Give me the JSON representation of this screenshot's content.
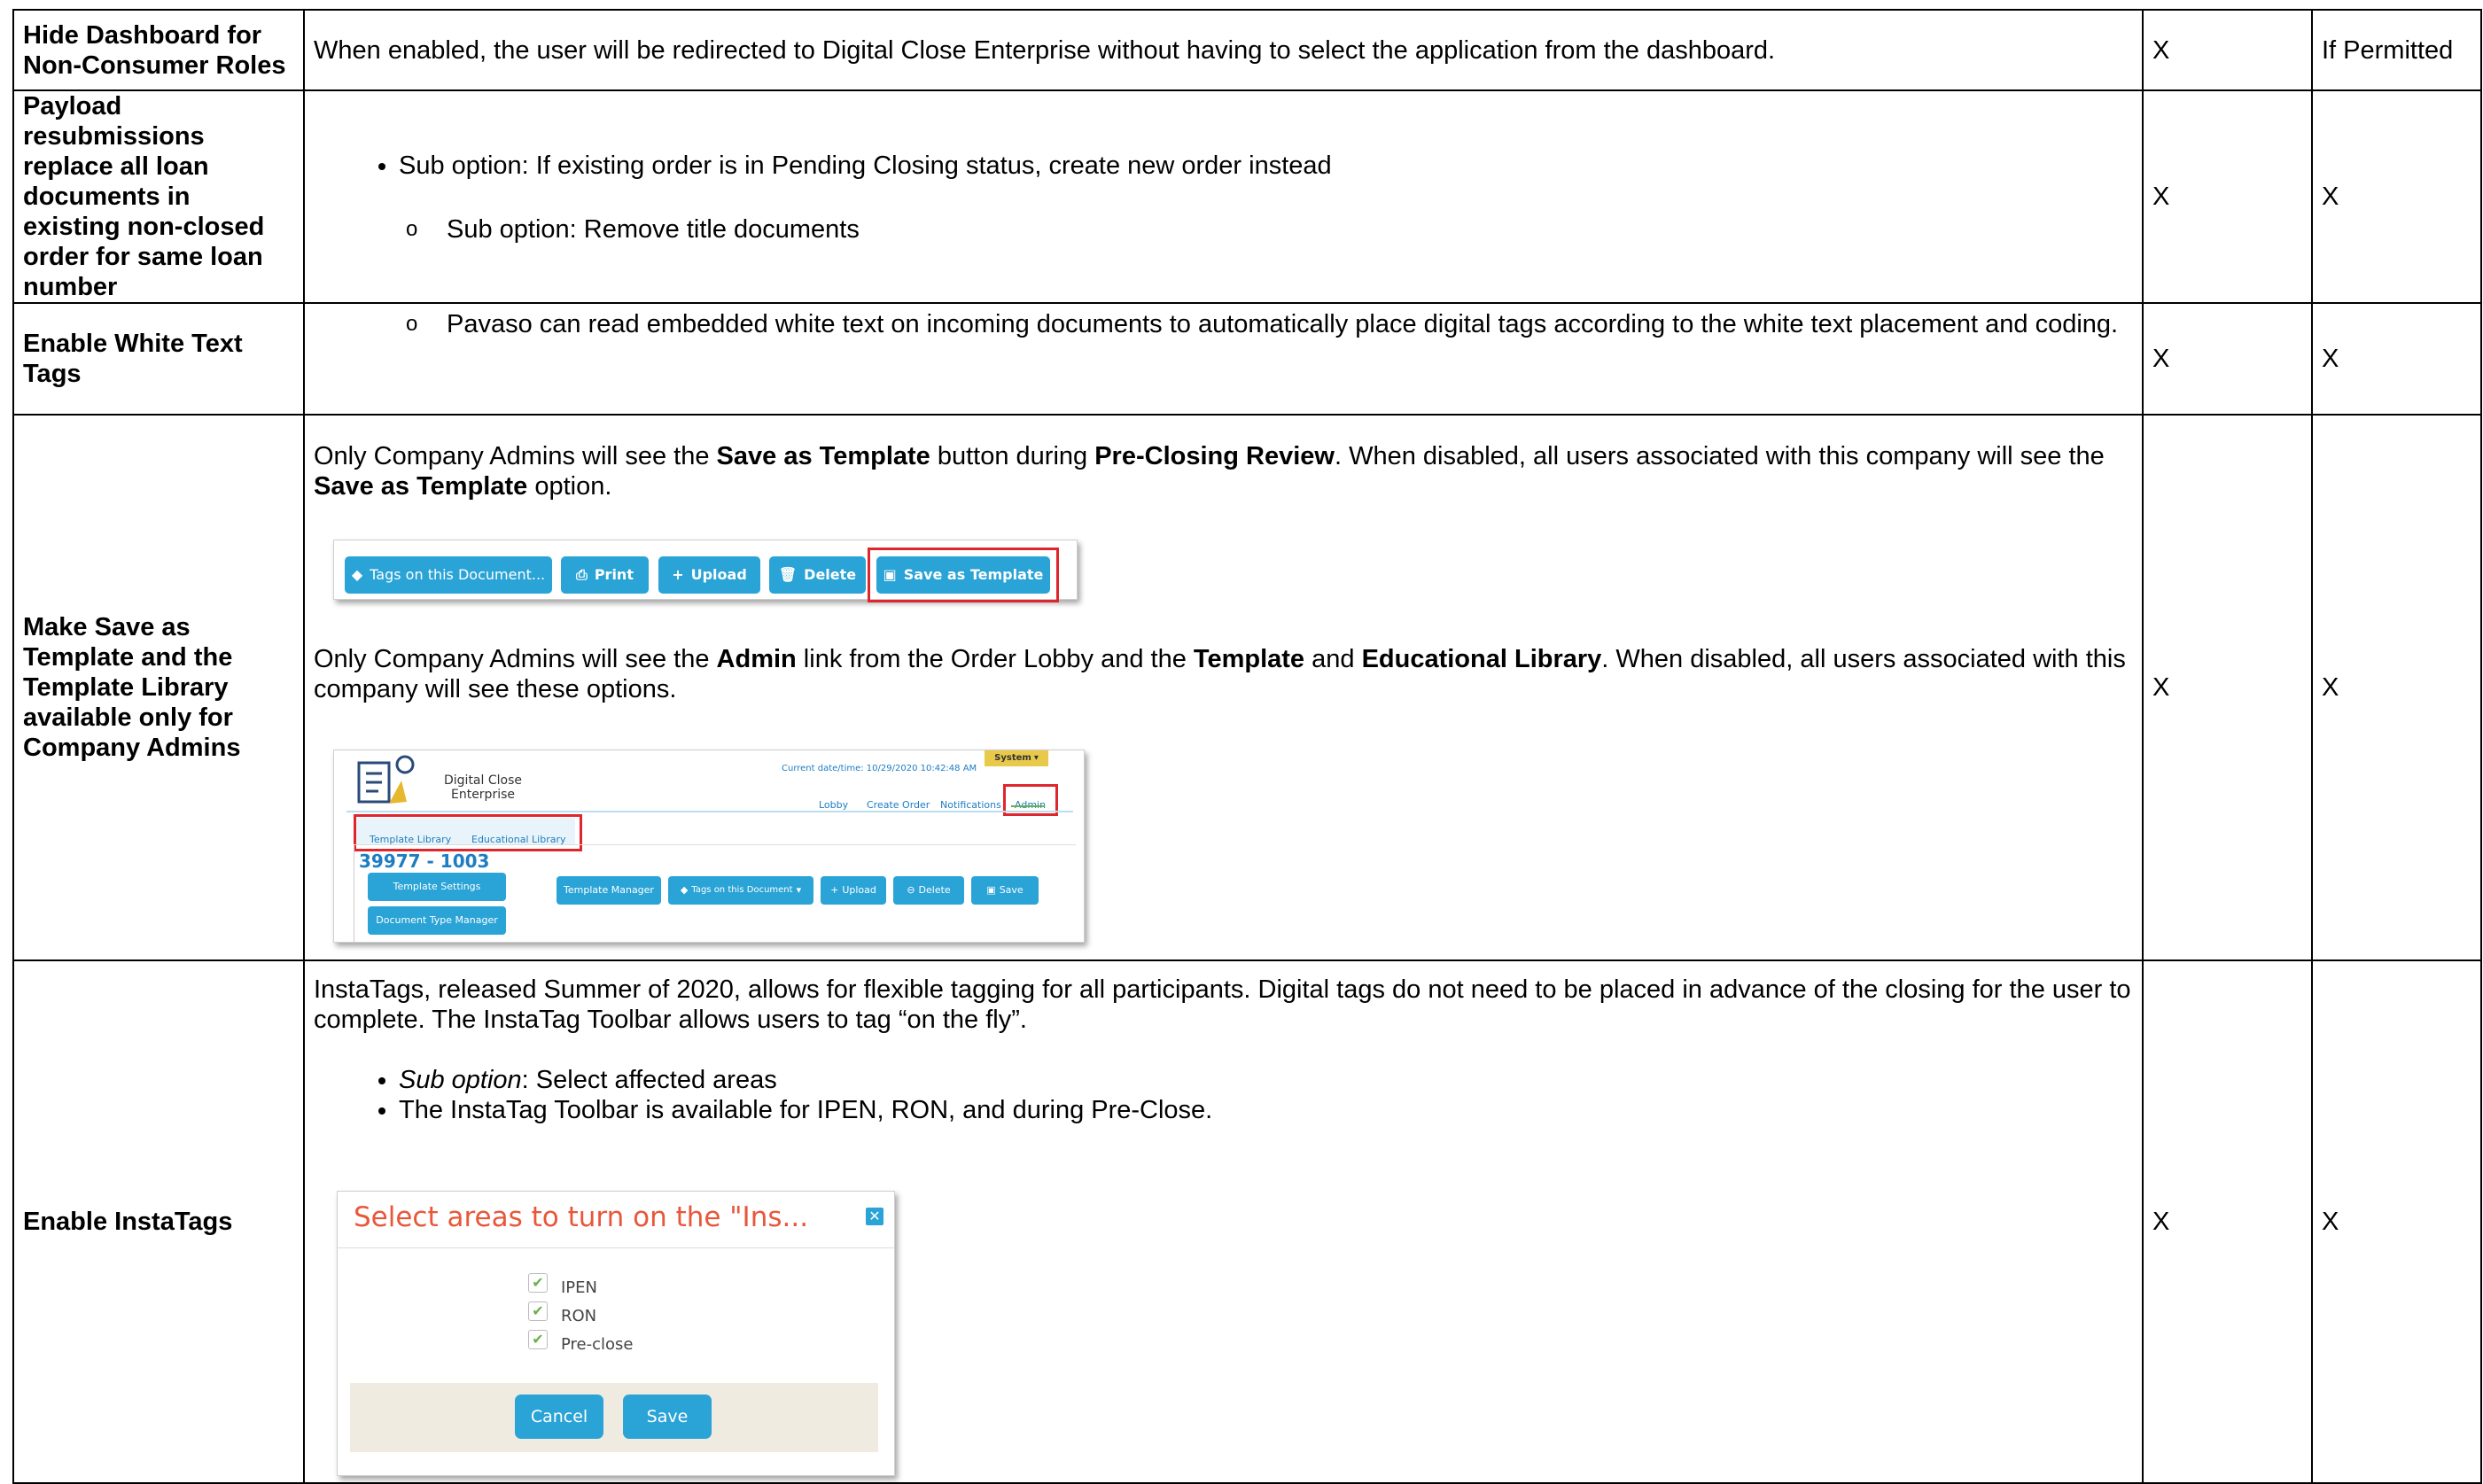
{
  "rows": [
    {
      "label": "Hide Dashboard for Non-Consumer Roles",
      "description": "When enabled, the user will be redirected to Digital Close Enterprise without having to select the application from the dashboard.",
      "col3": "X",
      "col4": "If Permitted"
    },
    {
      "label": "Payload resubmissions replace all loan documents in existing non-closed order for same loan number",
      "bullet": "Sub option: If existing order is in Pending Closing status, create new order instead",
      "sub_bullet": "Sub option: Remove title documents",
      "col3": "X",
      "col4": "X"
    },
    {
      "label": "Enable White Text Tags",
      "sub_bullet": "Pavaso can read embedded white text on incoming documents to automatically place digital tags according to the white text placement and coding.",
      "col3": "X",
      "col4": "X"
    },
    {
      "label": "Make Save as Template and the Template Library available only for Company Admins",
      "p1": {
        "t1": "Only Company Admins will see the ",
        "b1": "Save as Template",
        "t2": " button during ",
        "b2": "Pre-Closing Review",
        "t3": ". When disabled, all users associated with this company will see the ",
        "b3": "Save as Template",
        "t4": " option."
      },
      "p2": {
        "t1": "Only Company Admins will see the ",
        "b1": "Admin",
        "t2": " link from the Order Lobby and the ",
        "b2": "Template",
        "t3": " and ",
        "b3": "Educational Library",
        "t4": ". When disabled, all users associated with this company will see these options."
      },
      "col3": "X",
      "col4": "X"
    },
    {
      "label": "Enable InstaTags",
      "intro": "InstaTags, released Summer of 2020, allows for flexible tagging for all participants. Digital tags do not need to be placed in advance of the closing for the user to complete. The InstaTag Toolbar allows users to tag “on the fly”.",
      "bullet1_italic": "Sub option",
      "bullet1_rest": ": Select affected areas",
      "bullet2": "The InstaTag Toolbar is available for IPEN, RON, and during Pre-Close.",
      "col3": "X",
      "col4": "X"
    }
  ],
  "toolbar_shot": {
    "buttons": [
      "Tags on this Document...",
      "Print",
      "Upload",
      "Delete",
      "Save as Template"
    ]
  },
  "admin_shot": {
    "brand_line1": "Digital Close",
    "brand_line2": "Enterprise",
    "datetime": "Current date/time: 10/29/2020 10:42:48 AM",
    "system": "System",
    "nav": [
      "Lobby",
      "Create Order",
      "Notifications",
      "Admin"
    ],
    "tabs": [
      "Template Library",
      "Educational Library"
    ],
    "order_id": "39977 - 1003",
    "side_buttons": [
      "Template Settings",
      "Document Type Manager"
    ],
    "buttons": [
      "Template Manager",
      "Tags on this Document",
      "Upload",
      "Delete",
      "Save"
    ]
  },
  "dialog_shot": {
    "title": "Select areas to turn on the \"Ins...",
    "options": [
      "IPEN",
      "RON",
      "Pre-close"
    ],
    "cancel": "Cancel",
    "save": "Save"
  },
  "colors": {
    "button": "#2aa3d6",
    "highlight": "#e0262d",
    "dialog_title": "#e8573a",
    "order_id": "#1d7dc2"
  }
}
